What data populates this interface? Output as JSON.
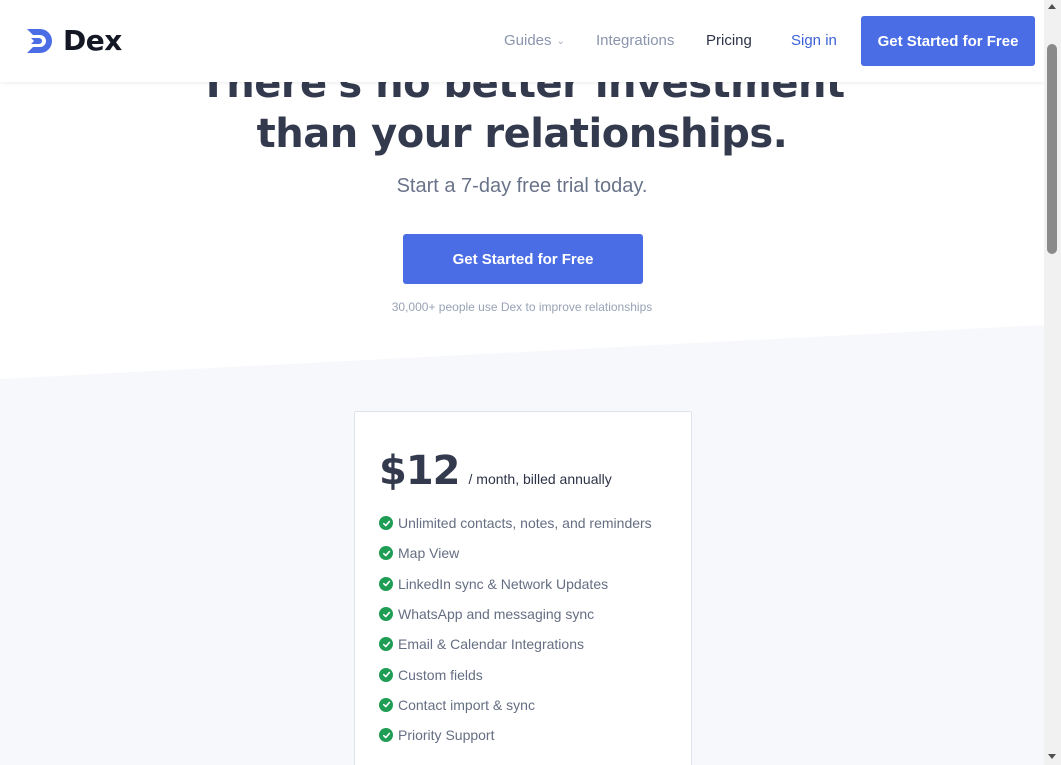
{
  "brand": {
    "name": "Dex",
    "accent": "#4a6de5",
    "logo_icon": "dex-logo-icon"
  },
  "nav": {
    "guides": "Guides",
    "integrations": "Integrations",
    "pricing": "Pricing",
    "sign_in": "Sign in",
    "cta": "Get Started for Free"
  },
  "hero": {
    "title_line1": "There's no better investment",
    "title_line2": "than your relationships.",
    "subtitle": "Start a 7-day free trial today.",
    "cta": "Get Started for Free",
    "note": "30,000+ people use Dex to improve relationships"
  },
  "pricing": {
    "price": "$12",
    "period": "/ month, billed annually",
    "check_color": "#1f9d55",
    "features": [
      "Unlimited contacts, notes, and reminders",
      "Map View",
      "LinkedIn sync & Network Updates",
      "WhatsApp and messaging sync",
      "Email & Calendar Integrations",
      "Custom fields",
      "Contact import & sync",
      "Priority Support"
    ]
  }
}
